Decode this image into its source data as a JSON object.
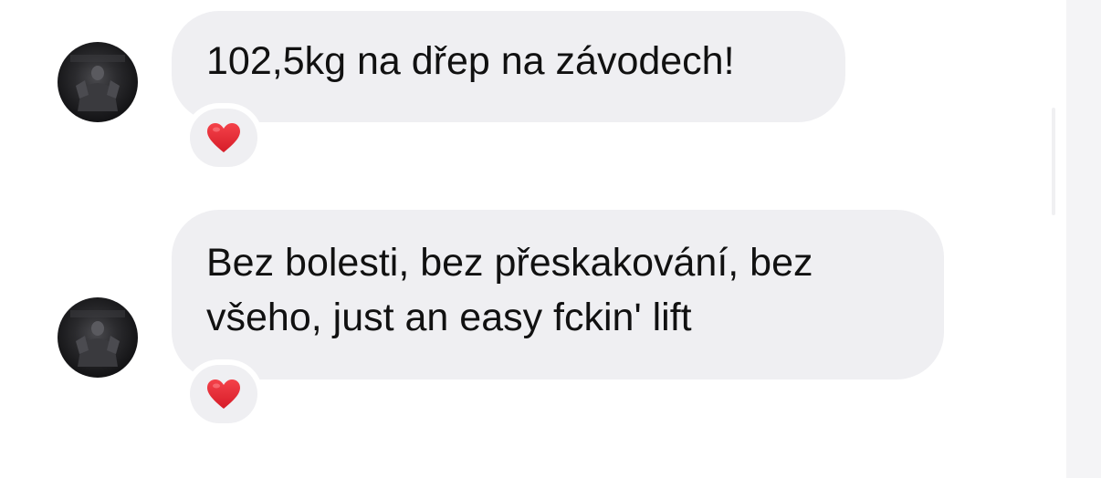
{
  "chat": {
    "messages": [
      {
        "text_lines": [
          "102,5kg na dřep na závodech!"
        ],
        "reaction": "heart-icon"
      },
      {
        "text_lines": [
          "Bez bolesti, bez přeskakování, bez",
          "všeho, just an easy fckin' lift"
        ],
        "reaction": "heart-icon"
      }
    ]
  },
  "colors": {
    "bubble": "#efeff2",
    "text": "#111111",
    "heart": "#e0232e"
  }
}
